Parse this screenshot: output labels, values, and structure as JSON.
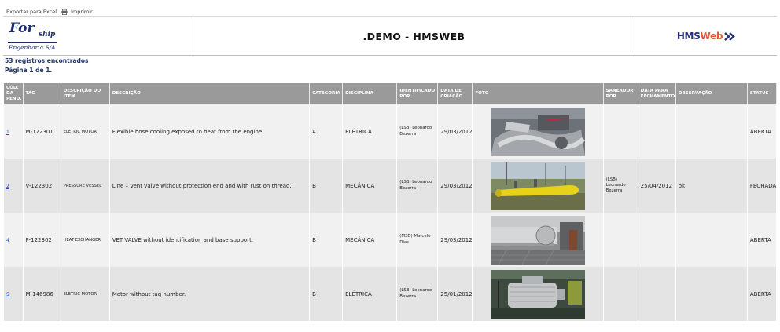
{
  "toolbar": {
    "export_label": "Exportar para Excel",
    "print_label": "Imprimir"
  },
  "header": {
    "logo_main": "For",
    "logo_sub": "ship",
    "logo_tagline": "Engenharia S/A",
    "title": ".DEMO - HMSWEB",
    "brand_a": "HMS",
    "brand_b": "Web"
  },
  "summary": {
    "records": "53 registros encontrados",
    "page": "Página 1 de 1."
  },
  "colors": {
    "header_bg": "#9a9a9a",
    "row_odd": "#f1f1f1",
    "row_even": "#e4e4e4",
    "link": "#2247b8",
    "brand_blue": "#2a2f7a",
    "brand_orange": "#e2593b"
  },
  "table": {
    "columns": [
      "CÓD. DA PEND.",
      "TAG",
      "DESCRIÇÃO DO ITEM",
      "DESCRIÇÃO",
      "CATEGORIA",
      "DISCIPLINA",
      "IDENTIFICADO POR",
      "DATA DE CRIAÇÃO",
      "FOTO",
      "SANEADOR POR",
      "DATA PARA FECHAMENTO",
      "OBSERVAÇÃO",
      "STATUS"
    ],
    "rows": [
      {
        "code": "1",
        "tag": "M-122301",
        "item": "ELETRIC MOTOR",
        "desc": "Flexible hose cooling exposed to heat from the engine.",
        "cat": "A",
        "disc": "ELÉTRICA",
        "ident": "(LSB) Leonardo Bezerra",
        "created": "29/03/2012",
        "photo": "photo-engine",
        "saneador": "",
        "close_date": "",
        "obs": "",
        "status": "ABERTA"
      },
      {
        "code": "2",
        "tag": "V-122302",
        "item": "PRESSURE VESSEL",
        "desc": "Line – Vent valve without protection end and with rust on thread.",
        "cat": "B",
        "disc": "MECÂNICA",
        "ident": "(LSB) Leonardo Bezerra",
        "created": "29/03/2012",
        "photo": "photo-vessel",
        "saneador": "(LSB) Leonardo Bezerra",
        "close_date": "25/04/2012",
        "obs": "ok",
        "status": "FECHADA"
      },
      {
        "code": "4",
        "tag": "P-122302",
        "item": "HEAT EXCHANGER",
        "desc": "VET VALVE without identification and base support.",
        "cat": "B",
        "disc": "MECÂNICA",
        "ident": "(MSD) Marcelo Dias",
        "created": "29/03/2012",
        "photo": "photo-exchanger",
        "saneador": "",
        "close_date": "",
        "obs": "",
        "status": "ABERTA"
      },
      {
        "code": "5",
        "tag": "M-146986",
        "item": "ELETRIC MOTOR",
        "desc": "Motor without tag number.",
        "cat": "B",
        "disc": "ELÉTRICA",
        "ident": "(LSB) Leonardo Bezerra",
        "created": "25/01/2012",
        "photo": "photo-motor",
        "saneador": "",
        "close_date": "",
        "obs": "",
        "status": "ABERTA"
      }
    ]
  }
}
